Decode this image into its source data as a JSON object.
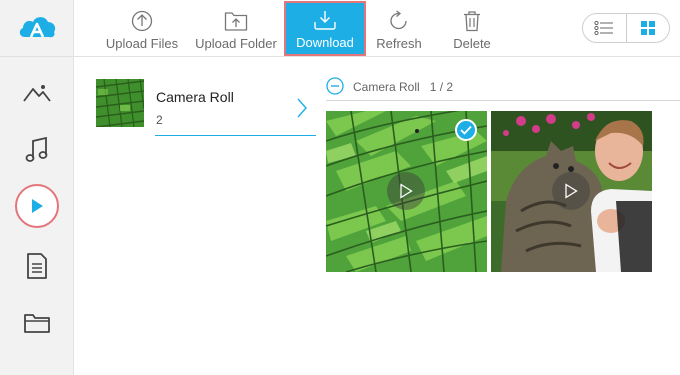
{
  "sidebar": {
    "logo_icon": "airmore-logo-icon",
    "items": [
      {
        "name": "photos",
        "icon": "mountains-icon"
      },
      {
        "name": "music",
        "icon": "music-note-icon"
      },
      {
        "name": "videos",
        "icon": "play-icon",
        "active": true
      },
      {
        "name": "documents",
        "icon": "document-icon"
      },
      {
        "name": "files",
        "icon": "folder-icon"
      }
    ],
    "accent_color": "#1eaee6",
    "highlight_color": "#e4757b"
  },
  "toolbar": {
    "upload_files_label": "Upload Files",
    "upload_folder_label": "Upload Folder",
    "download_label": "Download",
    "refresh_label": "Refresh",
    "delete_label": "Delete",
    "view_modes": [
      "list",
      "grid"
    ],
    "selected_view": "grid"
  },
  "album": {
    "title": "Camera Roll",
    "count": "2"
  },
  "content": {
    "breadcrumb": "Camera Roll",
    "page": "1 / 2",
    "videos": [
      {
        "subject": "green rice terraces",
        "selected": true
      },
      {
        "subject": "baby and cat",
        "selected": false
      }
    ]
  }
}
